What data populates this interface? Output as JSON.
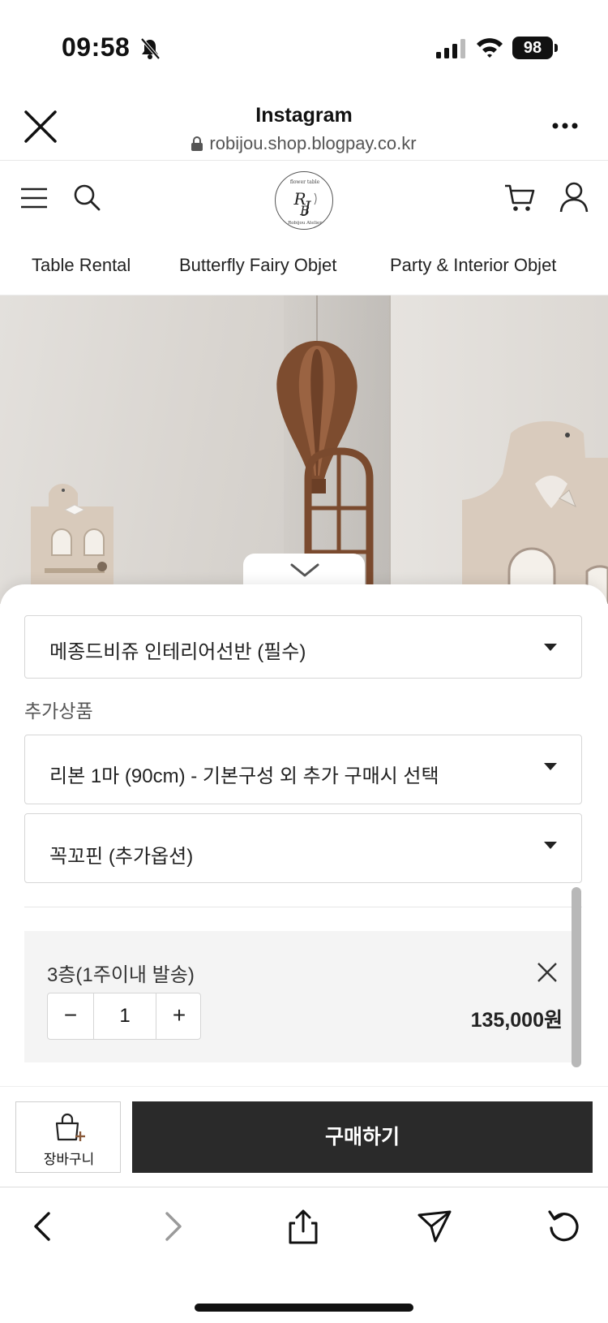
{
  "status_bar": {
    "time": "09:58",
    "battery": "98"
  },
  "browser": {
    "title": "Instagram",
    "url": "robijou.shop.blogpay.co.kr"
  },
  "site": {
    "nav": [
      "Table Rental",
      "Butterfly Fairy Objet",
      "Party & Interior Objet"
    ]
  },
  "options": {
    "main_select": "메종드비쥬 인테리어선반 (필수)",
    "addon_label": "추가상품",
    "addon_selects": [
      "리본 1마 (90cm) - 기본구성 외 추가 구매시 선택",
      "꼭꼬핀 (추가옵션)"
    ]
  },
  "selected_option": {
    "name": "3층(1주이내 발송)",
    "quantity": "1",
    "minus": "−",
    "plus": "+",
    "price": "135,000원"
  },
  "actions": {
    "cart_label": "장바구니",
    "buy_label": "구매하기"
  },
  "colors": {
    "buy_button": "#2a2a2a",
    "option_card": "#f4f4f4",
    "accent_brown": "#7a4a2e"
  }
}
